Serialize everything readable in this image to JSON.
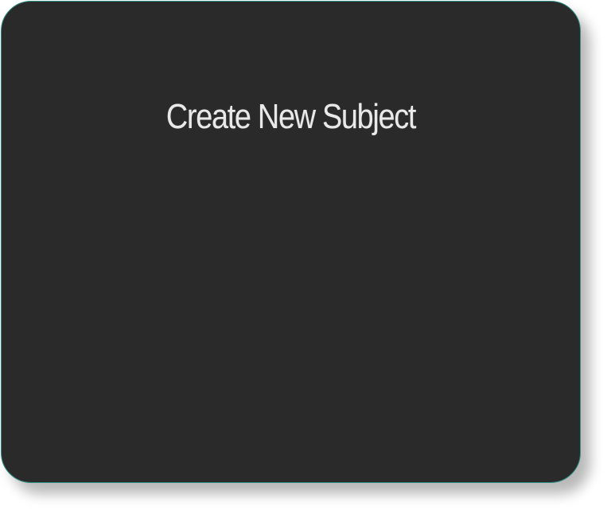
{
  "dialog": {
    "title": "Create New Subject"
  },
  "colors": {
    "dialog_background": "#2a2a2a",
    "dialog_border": "#2f8f86",
    "title_text": "#e9e9e9"
  }
}
